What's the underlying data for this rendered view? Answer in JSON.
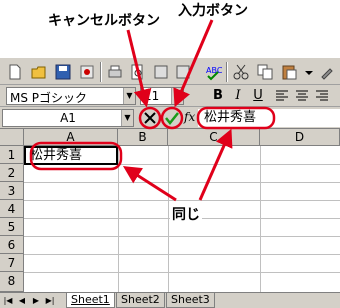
{
  "callouts": {
    "cancel": "キャンセルボタン",
    "enter": "入力ボタン",
    "same": "同じ"
  },
  "toolbar": {
    "font_name": "MS Pゴシック",
    "font_size": "11",
    "bold": "B",
    "italic": "I",
    "underline": "U"
  },
  "formula_bar": {
    "name_box": "A1",
    "fx": "fx",
    "value": "松井秀喜"
  },
  "grid": {
    "columns": [
      "A",
      "B",
      "C",
      "D"
    ],
    "rows": [
      "1",
      "2",
      "3",
      "4",
      "5",
      "6",
      "7",
      "8"
    ],
    "cell_a1": "松井秀喜"
  },
  "sheets": [
    "Sheet1",
    "Sheet2",
    "Sheet3"
  ],
  "colors": {
    "highlight": "#e0001a",
    "toolbar": "#d4d0c8"
  }
}
